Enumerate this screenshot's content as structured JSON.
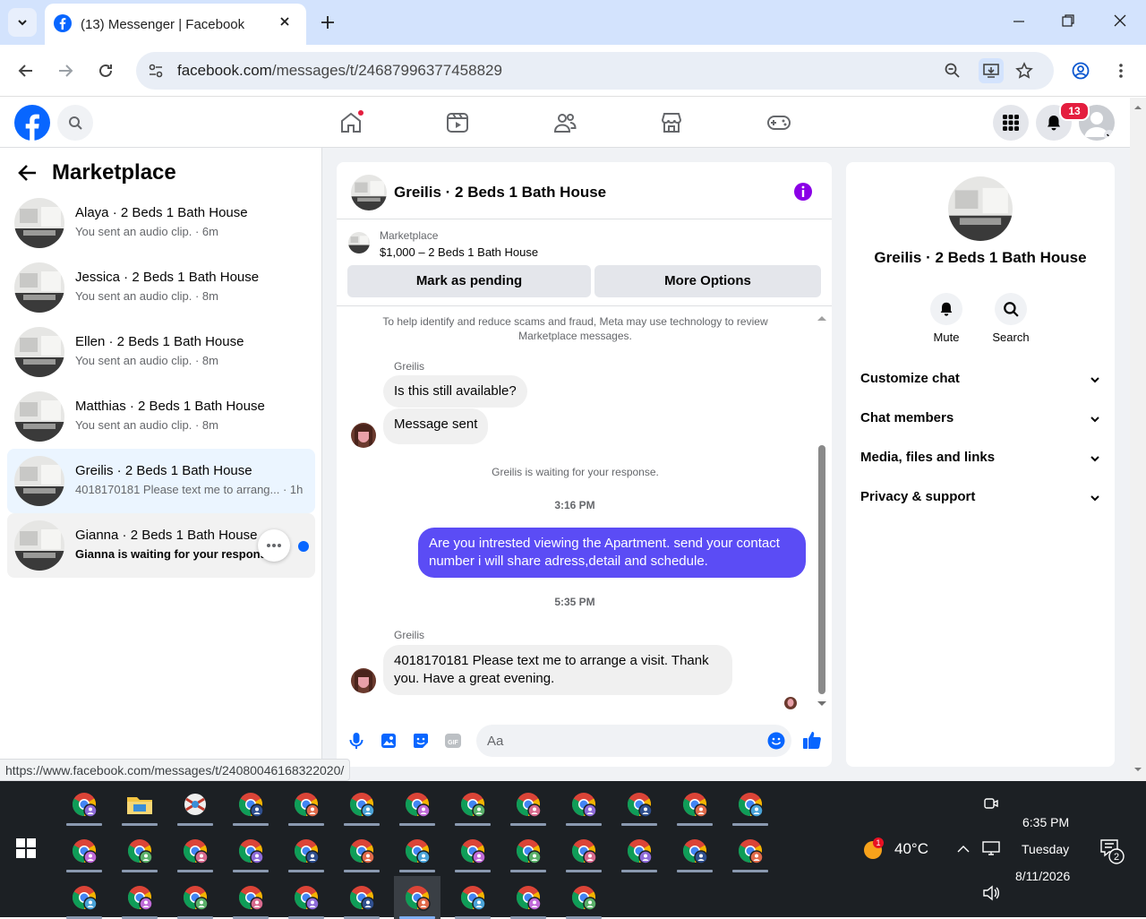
{
  "browser": {
    "tab_title": "(13) Messenger | Facebook",
    "url_host": "facebook.com",
    "url_path": "/messages/t/24687996377458829"
  },
  "fb": {
    "notification_count": "13"
  },
  "left": {
    "title": "Marketplace",
    "conversations": [
      {
        "name": "Alaya · 2 Beds 1 Bath House",
        "preview": "You sent an audio clip. · 6m"
      },
      {
        "name": "Jessica · 2 Beds 1 Bath House",
        "preview": "You sent an audio clip. · 8m"
      },
      {
        "name": "Ellen · 2 Beds 1 Bath House",
        "preview": "You sent an audio clip. · 8m"
      },
      {
        "name": "Matthias · 2 Beds 1 Bath House",
        "preview": "You sent an audio clip. · 8m"
      },
      {
        "name": "Greilis · 2 Beds 1 Bath House",
        "preview": "4018170181 Please text me to arrang... · 1h"
      },
      {
        "name": "Gianna · 2 Beds 1 Bath House",
        "preview": "Gianna is waiting for your response."
      }
    ]
  },
  "chat": {
    "title": "Greilis · 2 Beds 1 Bath House",
    "listing_source": "Marketplace",
    "listing_price": "$1,000 – 2 Beds 1 Bath House",
    "btn_pending": "Mark as pending",
    "btn_more": "More Options",
    "safety_note": "To help identify and reduce scams and fraud, Meta may use technology to review Marketplace messages.",
    "sender1": "Greilis",
    "msg1": "Is this still available?",
    "msg2": "Message sent",
    "waiting_note": "Greilis is waiting for your response.",
    "time1": "3:16 PM",
    "msg_out": "Are you intrested viewing the Apartment. send your contact number i will share adress,detail and schedule.",
    "time2": "5:35 PM",
    "sender2": "Greilis",
    "msg3": "4018170181 Please text me to arrange a visit. Thank you. Have a great evening.",
    "input_placeholder": "Aa"
  },
  "info": {
    "title": "Greilis · 2 Beds 1 Bath House",
    "mute_label": "Mute",
    "search_label": "Search",
    "sections": [
      "Customize chat",
      "Chat members",
      "Media, files and links",
      "Privacy & support"
    ]
  },
  "status_url": "https://www.facebook.com/messages/t/24080046168322020/",
  "taskbar": {
    "weather_badge": "1",
    "temperature": "40°C",
    "time": "6:35 PM",
    "day": "Tuesday",
    "date": "8/11/2026",
    "notif_count": "2"
  },
  "colors": {
    "fb_blue": "#0866ff",
    "outgoing_bubble": "#5b4cf5",
    "tab_strip": "#d3e3fd",
    "taskbar": "#1c2024"
  }
}
